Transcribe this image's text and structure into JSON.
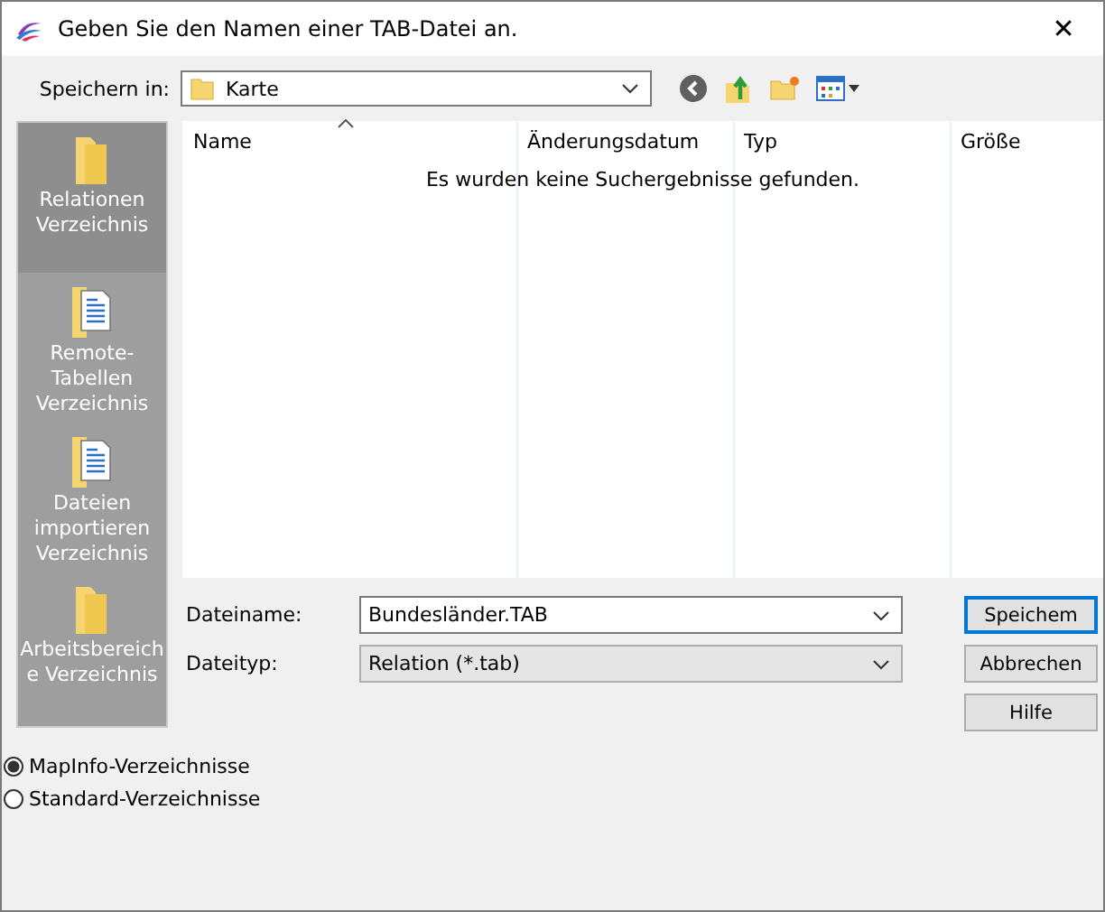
{
  "window": {
    "title": "Geben Sie den Namen einer TAB-Datei an.",
    "close": "✕"
  },
  "location": {
    "label": "Speichern in:",
    "value": "Karte"
  },
  "sidebar": {
    "items": [
      {
        "label": "Relationen Verzeichnis",
        "kind": "folder",
        "selected": true
      },
      {
        "label": "Remote-Tabellen Verzeichnis",
        "kind": "document",
        "selected": false
      },
      {
        "label": "Dateien importieren Verzeichnis",
        "kind": "document",
        "selected": false
      },
      {
        "label": "Arbeitsbereiche Verzeichnis",
        "kind": "folder",
        "selected": false
      }
    ]
  },
  "table": {
    "columns": [
      "Name",
      "Änderungsdatum",
      "Typ",
      "Größe"
    ],
    "empty_message": "Es wurden keine Suchergebnisse gefunden."
  },
  "filename": {
    "label": "Dateiname:",
    "value": "Bundesländer.TAB"
  },
  "filetype": {
    "label": "Dateityp:",
    "value": "Relation (*.tab)"
  },
  "buttons": [
    {
      "label": "Speichem",
      "default": true
    },
    {
      "label": "Abbrechen",
      "default": false
    },
    {
      "label": "Hilfe",
      "default": false
    }
  ],
  "options": [
    {
      "label": "MapInfo-Verzeichnisse",
      "selected": true
    },
    {
      "label": "Standard-Verzeichnisse",
      "selected": false
    }
  ]
}
